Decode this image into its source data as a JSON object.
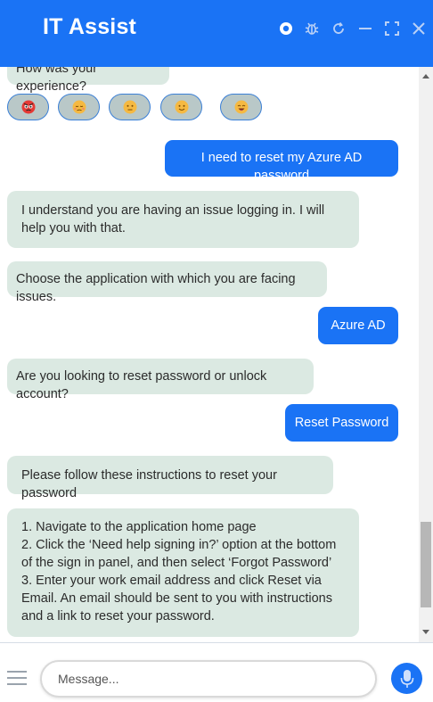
{
  "header": {
    "title": "IT Assist",
    "icons": [
      "record-icon",
      "bug-icon",
      "refresh-icon",
      "minimize-icon",
      "maximize-icon",
      "close-icon"
    ]
  },
  "chat": {
    "feedback_prompt": "How was your experience?",
    "feedback_emojis": [
      "angry",
      "sad",
      "neutral",
      "happy",
      "very-happy"
    ],
    "messages": [
      {
        "from": "user",
        "text": "I need to reset my Azure AD password"
      },
      {
        "from": "bot",
        "text": "I understand you are having an issue logging in. I will help you with that."
      },
      {
        "from": "bot",
        "text": "Choose the application with which you are facing issues."
      },
      {
        "from": "user",
        "text": "Azure AD"
      },
      {
        "from": "bot",
        "text": "Are you looking to reset password or unlock account?"
      },
      {
        "from": "user",
        "text": "Reset Password"
      },
      {
        "from": "bot",
        "text": "Please follow these instructions to reset your password"
      },
      {
        "from": "bot",
        "lines": [
          "1. Navigate to the application home page",
          "2. Click the ‘Need help signing in?’ option at the bottom of the sign in panel, and then select ‘Forgot Password’",
          "3. Enter your work email address and click Reset via Email. An email should be sent to you with instructions and a link to reset your password."
        ]
      }
    ]
  },
  "footer": {
    "input_placeholder": "Message..."
  },
  "colors": {
    "accent": "#1a73f5",
    "bot_bubble": "#dbe9e2"
  }
}
